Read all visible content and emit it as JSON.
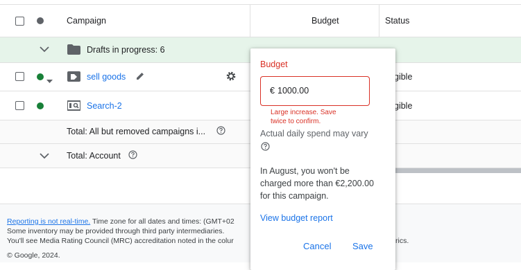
{
  "header": {
    "campaign_col": "Campaign",
    "budget_col": "Budget",
    "status_col": "Status"
  },
  "drafts": {
    "label": "Drafts in progress: 6"
  },
  "rows": [
    {
      "name": "sell goods",
      "status": "gible",
      "dot_color": "#188038"
    },
    {
      "name": "Search-2",
      "status": "gible",
      "dot_color": "#188038"
    }
  ],
  "totals": {
    "all_but_removed": "Total: All but removed campaigns i...",
    "account": "Total: Account"
  },
  "footer": {
    "realtime_link": "Reporting is not real-time.",
    "timezone": " Time zone for all dates and times: (GMT+02",
    "inventory": "Some inventory may be provided through third party intermediaries.",
    "mrc": "You'll see Media Rating Council (MRC) accreditation noted in the colur",
    "mrc_tail": "rics.",
    "copyright": "© Google, 2024."
  },
  "popup": {
    "title": "Budget",
    "currency": "€",
    "value": "1000.00",
    "warning_line1": "Large increase. Save",
    "warning_line2": "twice to confirm.",
    "spend_note": "Actual daily spend may vary",
    "august_note_1": "In August, you won't be",
    "august_note_2": "charged more than €2,200.00",
    "august_note_3": "for this campaign.",
    "report_link": "View budget report",
    "cancel": "Cancel",
    "save": "Save"
  },
  "colors": {
    "accent": "#1a73e8",
    "error": "#d93025",
    "drafts_bg": "#e6f4ea",
    "enabled": "#188038"
  },
  "icons": {
    "header_status": "status-dot-icon",
    "drafts": "folder-icon",
    "sell_goods": "tag-icon",
    "edit": "pencil-icon",
    "settings": "gear-icon",
    "search2": "search-campaign-icon",
    "help": "help-circle-icon",
    "expand": "chevron-down-icon"
  }
}
